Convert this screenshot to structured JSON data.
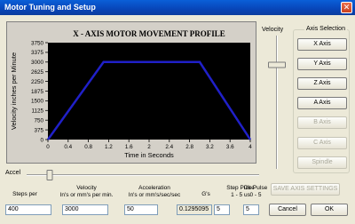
{
  "window": {
    "title": "Motor Tuning and Setup",
    "close_label": "✕"
  },
  "chart_data": {
    "type": "line",
    "title": "X - AXIS MOTOR MOVEMENT PROFILE",
    "xlabel": "Time in Seconds",
    "ylabel": "Velocity inches per Minute",
    "x": [
      0,
      1.1,
      3.0,
      4.0
    ],
    "y": [
      0,
      3000,
      3000,
      0
    ],
    "xlim": [
      0,
      4
    ],
    "ylim": [
      0,
      3750
    ],
    "xticks": [
      "0",
      "0.4",
      "0.8",
      "1.2",
      "1.6",
      "2",
      "2.4",
      "2.8",
      "3.2",
      "3.6",
      "4"
    ],
    "yticks": [
      "0",
      "375",
      "750",
      "1125",
      "1500",
      "1875",
      "2250",
      "2625",
      "3000",
      "3375",
      "3750"
    ],
    "line_color": "#2020c8",
    "plot_background": "#000000",
    "grid": false
  },
  "velocity_slider": {
    "label": "Velocity",
    "level": 0.78
  },
  "accel_slider": {
    "label": "Accel",
    "level": 0.1
  },
  "axis_selection": {
    "legend": "Axis Selection",
    "buttons": [
      {
        "label": "X Axis",
        "enabled": true
      },
      {
        "label": "Y Axis",
        "enabled": true
      },
      {
        "label": "Z Axis",
        "enabled": true
      },
      {
        "label": "A Axis",
        "enabled": true
      },
      {
        "label": "B Axis",
        "enabled": false
      },
      {
        "label": "C Axis",
        "enabled": false
      },
      {
        "label": "Spindle",
        "enabled": false
      }
    ]
  },
  "fields": {
    "steps_per_label": "Steps per",
    "steps_per_value": "400",
    "velocity_label_1": "Velocity",
    "velocity_label_2": "In's or mm's per min.",
    "velocity_value": "3000",
    "acceleration_label_1": "Acceleration",
    "acceleration_label_2": "In's or mm's/sec/sec",
    "acceleration_value": "50",
    "gs_label": "G's",
    "gs_value": "0.1295095",
    "step_pulse_label_1": "Step Pulse",
    "step_pulse_label_2": "1 - 5 us",
    "step_pulse_value": "5",
    "dir_pulse_label_1": "Dir Pulse",
    "dir_pulse_label_2": "0 - 5",
    "dir_pulse_value": "5"
  },
  "buttons": {
    "save": "SAVE AXIS SETTINGS",
    "cancel": "Cancel",
    "ok": "OK"
  }
}
